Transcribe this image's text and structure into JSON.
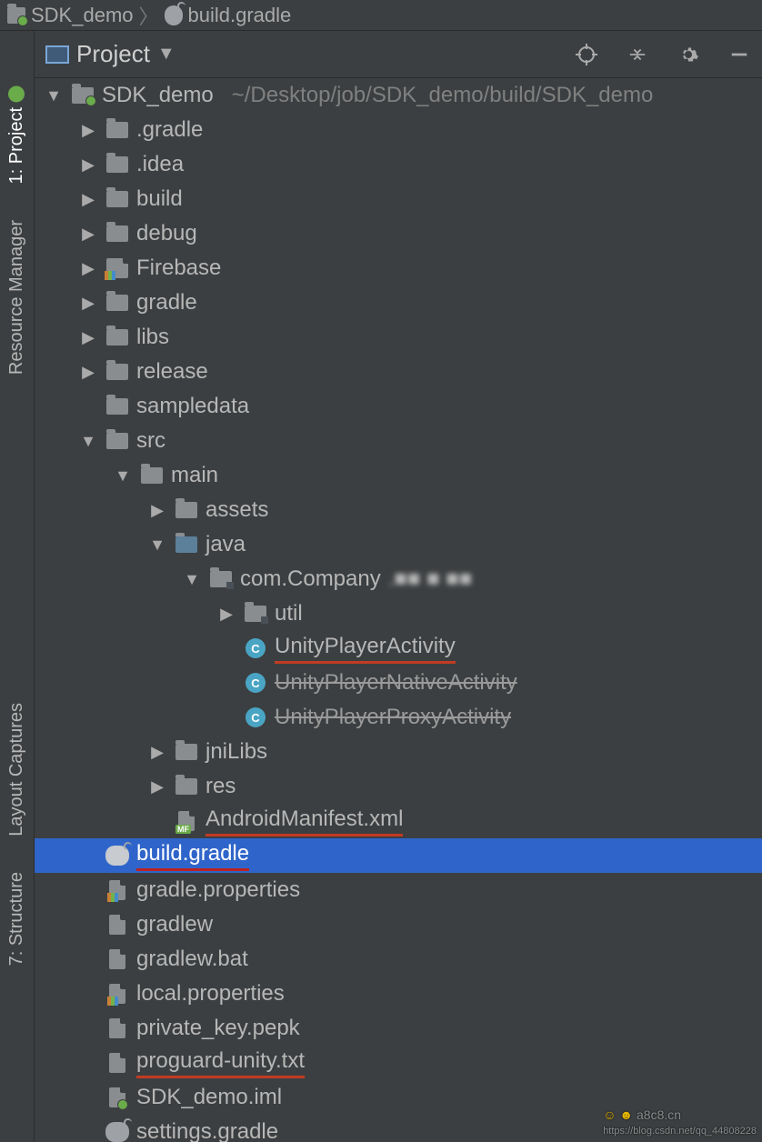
{
  "breadcrumb": {
    "project": "SDK_demo",
    "file": "build.gradle"
  },
  "toolbar": {
    "view": "Project"
  },
  "sidebar_tabs": {
    "project": "1: Project",
    "resmgr": "Resource Manager",
    "layout": "Layout Captures",
    "structure": "7: Structure"
  },
  "tree": {
    "root_name": "SDK_demo",
    "root_path": "~/Desktop/job/SDK_demo/build/SDK_demo",
    "children": [
      {
        "name": ".gradle",
        "type": "folder"
      },
      {
        "name": ".idea",
        "type": "folder"
      },
      {
        "name": "build",
        "type": "folder"
      },
      {
        "name": "debug",
        "type": "folder"
      },
      {
        "name": "Firebase",
        "type": "folder-props"
      },
      {
        "name": "gradle",
        "type": "folder"
      },
      {
        "name": "libs",
        "type": "folder"
      },
      {
        "name": "release",
        "type": "folder"
      },
      {
        "name": "sampledata",
        "type": "folder"
      }
    ],
    "src": {
      "name": "src",
      "main": {
        "name": "main",
        "assets": "assets",
        "java": {
          "name": "java",
          "pkg": "com.Company",
          "util": "util",
          "classes": [
            {
              "name": "UnityPlayerActivity",
              "hl": true
            },
            {
              "name": "UnityPlayerNativeActivity",
              "strike": true
            },
            {
              "name": "UnityPlayerProxyActivity",
              "strike": true
            }
          ]
        },
        "jniLibs": "jniLibs",
        "res": "res",
        "manifest": "AndroidManifest.xml"
      }
    },
    "files": [
      {
        "name": "build.gradle",
        "type": "gradle",
        "selected": true,
        "hl": true
      },
      {
        "name": "gradle.properties",
        "type": "file-props"
      },
      {
        "name": "gradlew",
        "type": "file"
      },
      {
        "name": "gradlew.bat",
        "type": "file"
      },
      {
        "name": "local.properties",
        "type": "file-props"
      },
      {
        "name": "private_key.pepk",
        "type": "file"
      },
      {
        "name": "proguard-unity.txt",
        "type": "file",
        "hl": true
      },
      {
        "name": "SDK_demo.iml",
        "type": "file-iml"
      },
      {
        "name": "settings.gradle",
        "type": "gradle"
      }
    ]
  },
  "watermark": {
    "site": "a8c8.cn",
    "blog": "https://blog.csdn.net/qq_44808228"
  }
}
